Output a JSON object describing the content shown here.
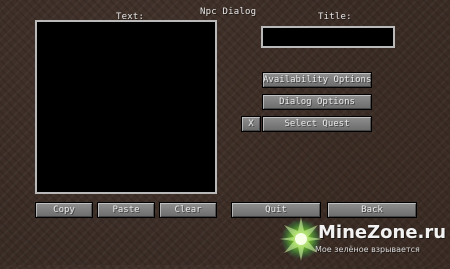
{
  "labels": {
    "text": "Text:",
    "npc_dialog": "Npc Dialog",
    "title": "Title:"
  },
  "inputs": {
    "title_value": "",
    "text_value": ""
  },
  "buttons": {
    "availability": "Availability Options",
    "dialog": "Dialog Options",
    "x": "X",
    "select_quest": "Select Quest",
    "copy": "Copy",
    "paste": "Paste",
    "clear": "Clear",
    "quit": "Quit",
    "back": "Back"
  },
  "watermark": {
    "site": "MineZone.ru",
    "tagline": "Мое зелёное взрывается"
  },
  "icons": {
    "logo": "minezone-logo-icon"
  }
}
